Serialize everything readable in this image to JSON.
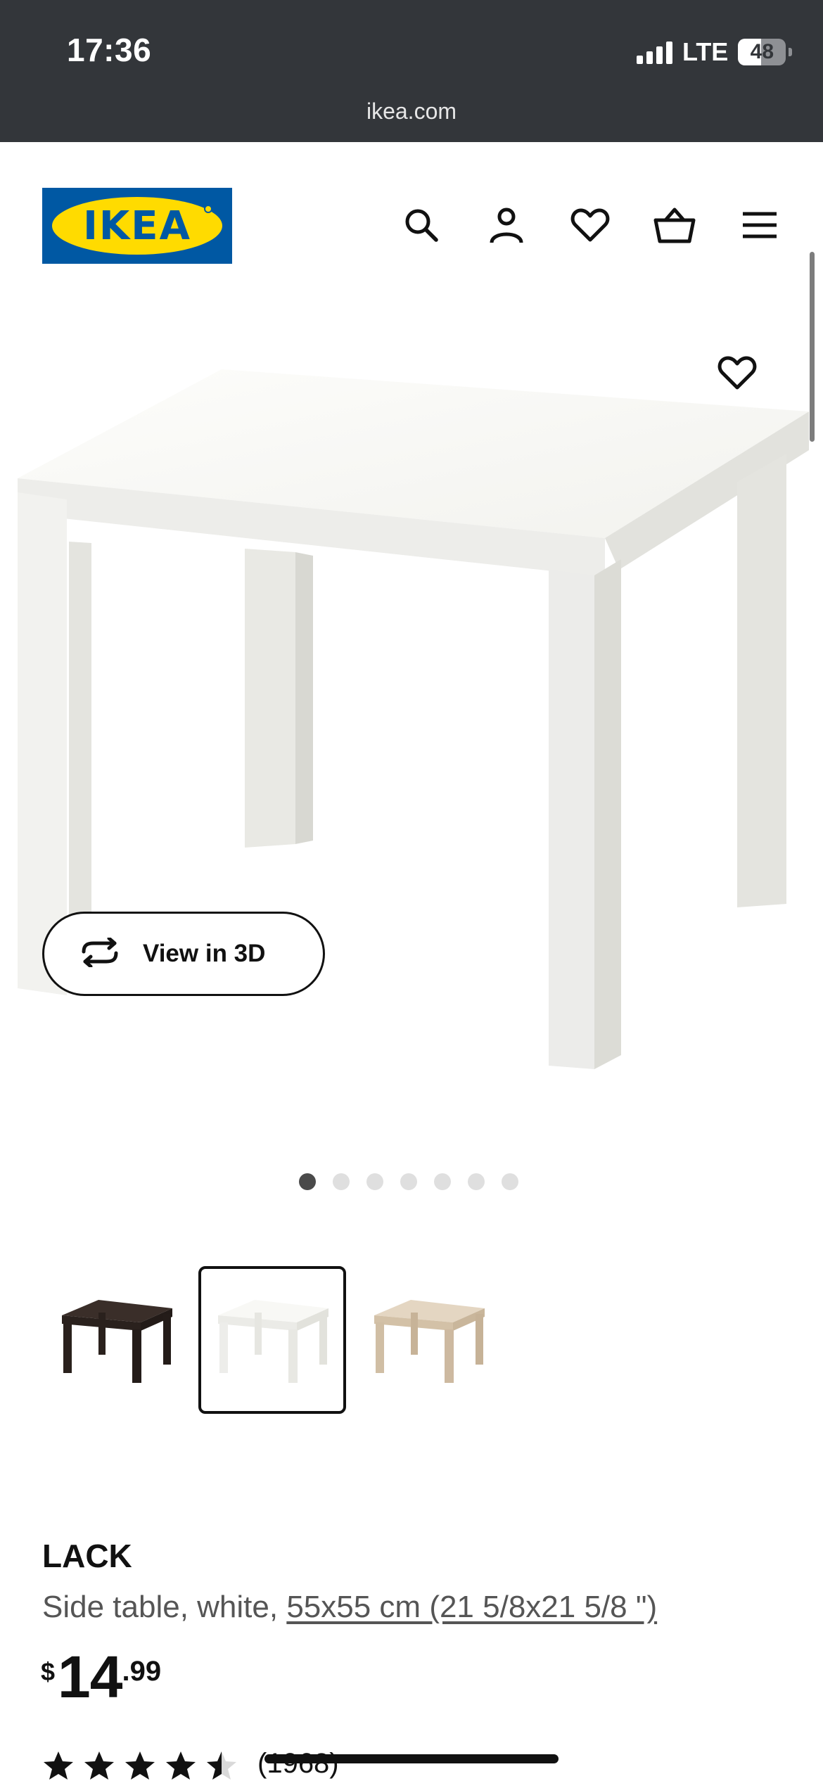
{
  "status_bar": {
    "time": "17:36",
    "network": "LTE",
    "battery": "48"
  },
  "browser": {
    "url": "ikea.com"
  },
  "header": {
    "logo_text": "IKEA",
    "icons": [
      "search-icon",
      "account-icon",
      "heart-icon",
      "basket-icon",
      "menu-icon"
    ]
  },
  "gallery": {
    "view_3d_label": "View in 3D",
    "image_count": 7,
    "active_index": 0
  },
  "variants": [
    {
      "name": "black-brown",
      "color": "#2a211d",
      "selected": false
    },
    {
      "name": "white",
      "color": "#f3f3ef",
      "selected": true
    },
    {
      "name": "white stained oak effect",
      "color": "#d8c7ae",
      "selected": false
    }
  ],
  "product": {
    "name": "LACK",
    "desc_prefix": "Side table, white, ",
    "dimensions": "55x55 cm (21 5/8x21 5/8 \")",
    "price_currency": "$",
    "price_int": "14",
    "price_dec": ".99",
    "rating": 4.5,
    "review_count": "(1968)"
  },
  "colors": {
    "status_bg": "#33363a",
    "ikea_blue": "#0058a3",
    "ikea_yellow": "#ffdb00"
  }
}
